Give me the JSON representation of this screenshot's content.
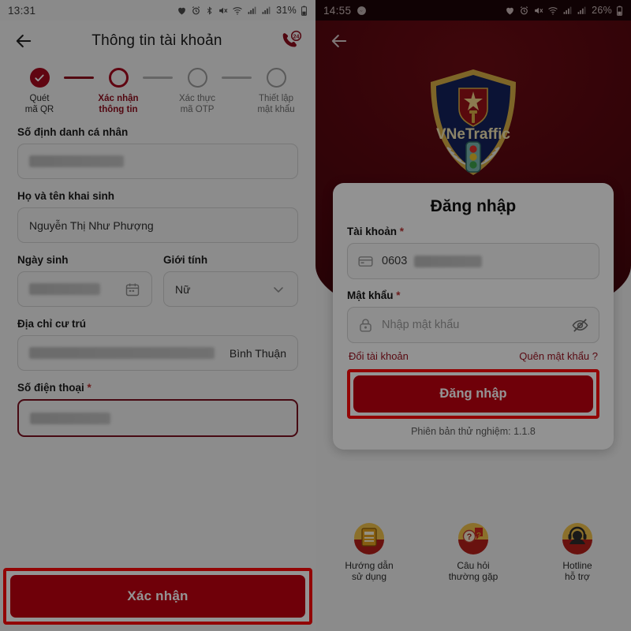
{
  "left_screen": {
    "status_bar": {
      "time": "13:31",
      "battery_percent": "31%",
      "icons": [
        "heart-icon",
        "alarm-icon",
        "bluetooth-icon",
        "mute-icon",
        "wifi-icon",
        "signal-icon",
        "signal-icon",
        "battery-icon"
      ]
    },
    "app_bar": {
      "back_icon": "back-arrow-icon",
      "title": "Thông tin tài khoản",
      "hotline_icon": "phone-24-icon",
      "hotline_badge": "24"
    },
    "stepper": [
      {
        "label_line1": "Quét",
        "label_line2": "mã QR",
        "state": "done"
      },
      {
        "label_line1": "Xác nhận",
        "label_line2": "thông tin",
        "state": "current"
      },
      {
        "label_line1": "Xác thực",
        "label_line2": "mã OTP",
        "state": "todo"
      },
      {
        "label_line1": "Thiết lập",
        "label_line2": "mật khẩu",
        "state": "todo"
      }
    ],
    "fields": {
      "personal_id": {
        "label": "Số định danh cá nhân",
        "value": "",
        "redacted": true
      },
      "full_name": {
        "label": "Họ và tên khai sinh",
        "value": "Nguyễn Thị Như Phượng",
        "redacted": false
      },
      "birth_date": {
        "label": "Ngày sinh",
        "value": "",
        "redacted": true,
        "trailing_icon": "calendar-icon"
      },
      "gender": {
        "label": "Giới tính",
        "value": "Nữ",
        "redacted": false,
        "trailing_icon": "chevron-down-icon"
      },
      "address": {
        "label": "Địa chỉ cư trú",
        "value": "Bình Thuận",
        "redacted": true
      },
      "phone": {
        "label": "Số điện thoại",
        "required_mark": "*",
        "value": "",
        "redacted": true,
        "highlighted": true
      }
    },
    "confirm_button": "Xác nhận"
  },
  "right_screen": {
    "status_bar": {
      "time": "14:55",
      "battery_percent": "26%",
      "icons": [
        "messenger-icon",
        "heart-icon",
        "alarm-icon",
        "mute-icon",
        "wifi-icon",
        "signal-icon",
        "signal-icon",
        "battery-icon"
      ]
    },
    "app_bar": {
      "back_icon": "back-arrow-icon"
    },
    "logo": {
      "name": "vnetraffic-shield-logo",
      "text": "VNeTraffic"
    },
    "login_card": {
      "title": "Đăng nhập",
      "account": {
        "label": "Tài khoản",
        "required_mark": "*",
        "value": "0603",
        "lead_icon": "card-icon",
        "redacted": true
      },
      "password": {
        "label": "Mật khẩu",
        "required_mark": "*",
        "placeholder": "Nhập mật khẩu",
        "value": "",
        "lead_icon": "lock-icon",
        "trailing_icon": "eye-off-icon"
      },
      "switch_account_link": "Đổi tài khoản",
      "forgot_password_link": "Quên mật khẩu ?",
      "submit_button": "Đăng nhập",
      "version_text": "Phiên bản thử nghiệm: 1.1.8"
    },
    "helpers": [
      {
        "icon": "guide-book-icon",
        "line1": "Hướng dẫn",
        "line2": "sử dụng"
      },
      {
        "icon": "faq-question-icon",
        "line1": "Câu hỏi",
        "line2": "thường gặp"
      },
      {
        "icon": "headset-icon",
        "line1": "Hotline",
        "line2": "hỗ trợ"
      }
    ]
  },
  "colors": {
    "brand_red": "#c00010",
    "dark_red": "#8e0d1c",
    "highlight_red": "#fb0a0a",
    "hero_red": "#58070f",
    "gold": "#e0a72c"
  }
}
